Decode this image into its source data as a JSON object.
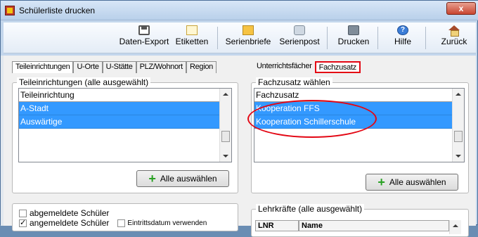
{
  "window": {
    "title": "Schülerliste drucken",
    "close_label": "x"
  },
  "toolbar": {
    "buttons": [
      {
        "label": "Daten-Export",
        "icon": "disk-icon"
      },
      {
        "label": "Etiketten",
        "icon": "mail-icon"
      },
      {
        "label": "Serienbriefe",
        "icon": "document-icon"
      },
      {
        "label": "Serienpost",
        "icon": "stamp-icon"
      },
      {
        "label": "Drucken",
        "icon": "printer-icon"
      },
      {
        "label": "Hilfe",
        "icon": "help-icon",
        "glyph": "?"
      },
      {
        "label": "Zurück",
        "icon": "home-icon"
      }
    ]
  },
  "left": {
    "tabs": [
      "Teileinrichtungen",
      "U-Orte",
      "U-Stätte",
      "PLZ/Wohnort",
      "Region"
    ],
    "group_title": "Teileinrichtungen (alle ausgewählt)",
    "list": {
      "header": "Teileinrichtung",
      "rows": [
        "A-Stadt",
        "Auswärtige"
      ]
    },
    "select_all": "Alle auswählen"
  },
  "right": {
    "tabs": [
      "Unterrichtsfächer",
      "Fachzusatz"
    ],
    "group_title": "Fachzusatz wählen",
    "list": {
      "header": "Fachzusatz",
      "rows": [
        "Kooperation FFS",
        "Kooperation Schillerschule"
      ]
    },
    "select_all": "Alle auswählen",
    "teachers_title": "Lehrkräfte (alle ausgewählt)",
    "teachers_columns": [
      "LNR",
      "Name"
    ]
  },
  "bottom_left": {
    "abgemeldete": "abgemeldete Schüler",
    "angemeldete": "angemeldete Schüler",
    "eintritt": "Eintrittsdatum verwenden"
  },
  "colors": {
    "selection": "#3399ff",
    "annotation": "#e30613",
    "plus": "#28a022"
  }
}
